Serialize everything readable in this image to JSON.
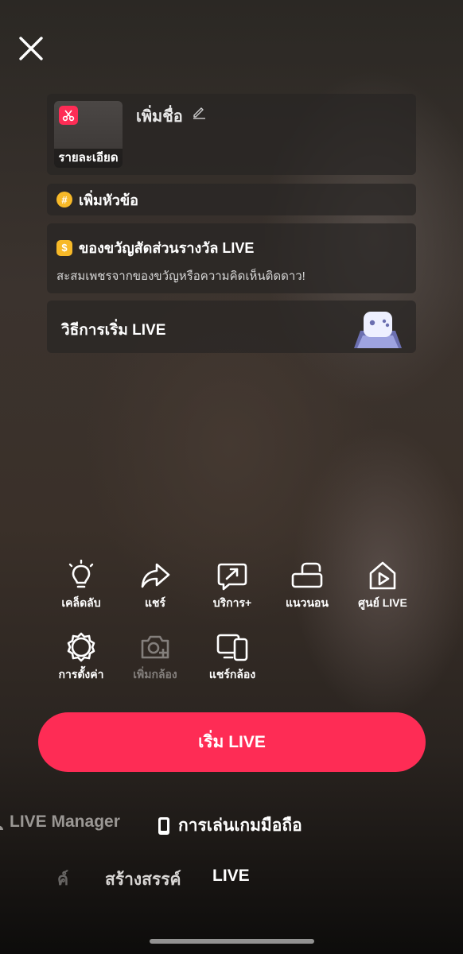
{
  "setup": {
    "close_icon": "close-icon",
    "title_card": {
      "thumbnail_label": "รายละเอียด",
      "title_placeholder": "เพิ่มชื่อ",
      "badge_icon": "scissors-icon",
      "edit_icon": "pencil-icon"
    },
    "topic": {
      "icon": "hashtag-icon",
      "label": "เพิ่มหัวข้อ"
    },
    "gifts": {
      "icon": "coin-icon",
      "title": "ของขวัญสัดส่วนรางวัล LIVE",
      "subtitle": "สะสมเพชรจากของขวัญหรือความคิดเห็นติดดาว!"
    },
    "howto": {
      "label": "วิธีการเริ่ม LIVE",
      "illustration": "game-controller-icon"
    }
  },
  "tools": [
    {
      "label": "เคล็ดลับ",
      "icon": "lightbulb-icon",
      "enabled": true
    },
    {
      "label": "แชร์",
      "icon": "share-arrow-icon",
      "enabled": true
    },
    {
      "label": "บริการ+",
      "icon": "services-chat-icon",
      "enabled": true
    },
    {
      "label": "แนวนอน",
      "icon": "landscape-rotate-icon",
      "enabled": true
    },
    {
      "label": "ศูนย์ LIVE",
      "icon": "live-center-icon",
      "enabled": true
    },
    {
      "label": "การตั้งค่า",
      "icon": "gear-icon",
      "enabled": true
    },
    {
      "label": "เพิ่มกล้อง",
      "icon": "add-camera-icon",
      "enabled": false
    },
    {
      "label": "แชร์กล้อง",
      "icon": "share-camera-icon",
      "enabled": true
    }
  ],
  "go_live_label": "เริ่ม LIVE",
  "modes": [
    {
      "label": "LIVE Manager",
      "icon": "person-icon"
    },
    {
      "label": "การเล่นเกมมือถือ",
      "icon": "phone-icon"
    }
  ],
  "bottom_tabs": [
    {
      "label": "ค์"
    },
    {
      "label": "สร้างสรรค์"
    },
    {
      "label": "LIVE",
      "active": true
    }
  ],
  "colors": {
    "accent": "#fe2c55",
    "coin": "#f7b928"
  }
}
